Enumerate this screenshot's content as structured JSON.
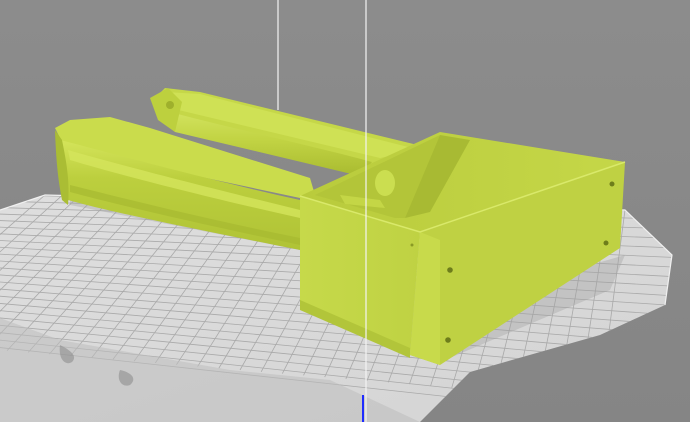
{
  "viewport": {
    "description_label": "",
    "background_color": "#8a8a8a",
    "model_color": "#c8dc4a",
    "build_plate_color": "#dcdcdc",
    "grid_line_color": "#a0a0a0",
    "z_axis_color": "#2233ff"
  }
}
